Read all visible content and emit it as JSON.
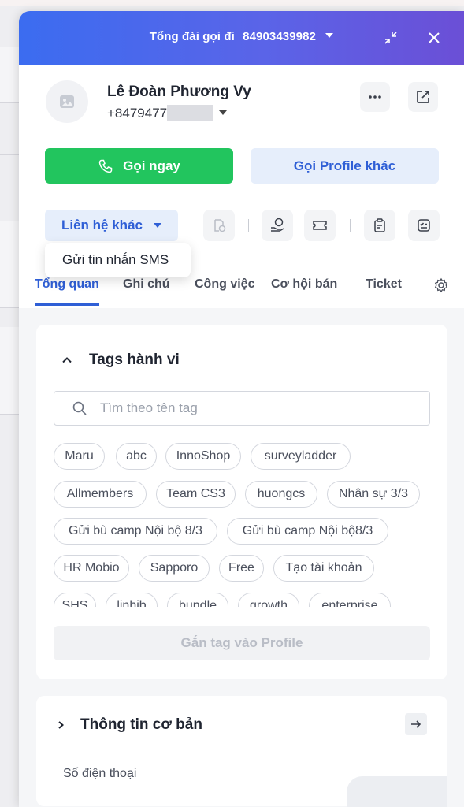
{
  "header": {
    "label": "Tổng đài gọi đi",
    "number": "84903439982"
  },
  "profile": {
    "name": "Lê Đoàn Phương Vy",
    "phone_visible": "+8479477"
  },
  "actions": {
    "call_label": "Gọi ngay",
    "call_other_label": "Gọi Profile khác"
  },
  "contact_menu": {
    "label": "Liên hệ khác",
    "options": [
      "Gửi tin nhắn SMS"
    ]
  },
  "tabs": [
    {
      "label": "Tổng quan",
      "active": true
    },
    {
      "label": "Ghi chú",
      "active": false
    },
    {
      "label": "Công việc",
      "active": false
    },
    {
      "label": "Cơ hội bán",
      "active": false
    },
    {
      "label": "Ticket",
      "active": false
    }
  ],
  "tags_section": {
    "title": "Tags hành vi",
    "search_placeholder": "Tìm theo tên tag",
    "tags": [
      "Maru",
      "abc",
      "InnoShop",
      "surveyladder",
      "Allmembers",
      "Team CS3",
      "huongcs",
      "Nhân sự 3/3",
      "Gửi bù camp Nội bộ 8/3",
      "Gửi bù camp Nội bộ8/3",
      "HR Mobio",
      "Sapporo",
      "Free",
      "Tạo tài khoản",
      "SHS",
      "linhjb",
      "bundle",
      "growth",
      "enterprise"
    ],
    "assign_label": "Gắn tag vào Profile"
  },
  "basic_info": {
    "title": "Thông tin cơ bản",
    "phone_label": "Số điện thoại"
  },
  "colors": {
    "primary": "#2f5fd6",
    "call_green": "#22c55e",
    "header_start": "#3b6cf0",
    "header_end": "#6b4fd6"
  }
}
